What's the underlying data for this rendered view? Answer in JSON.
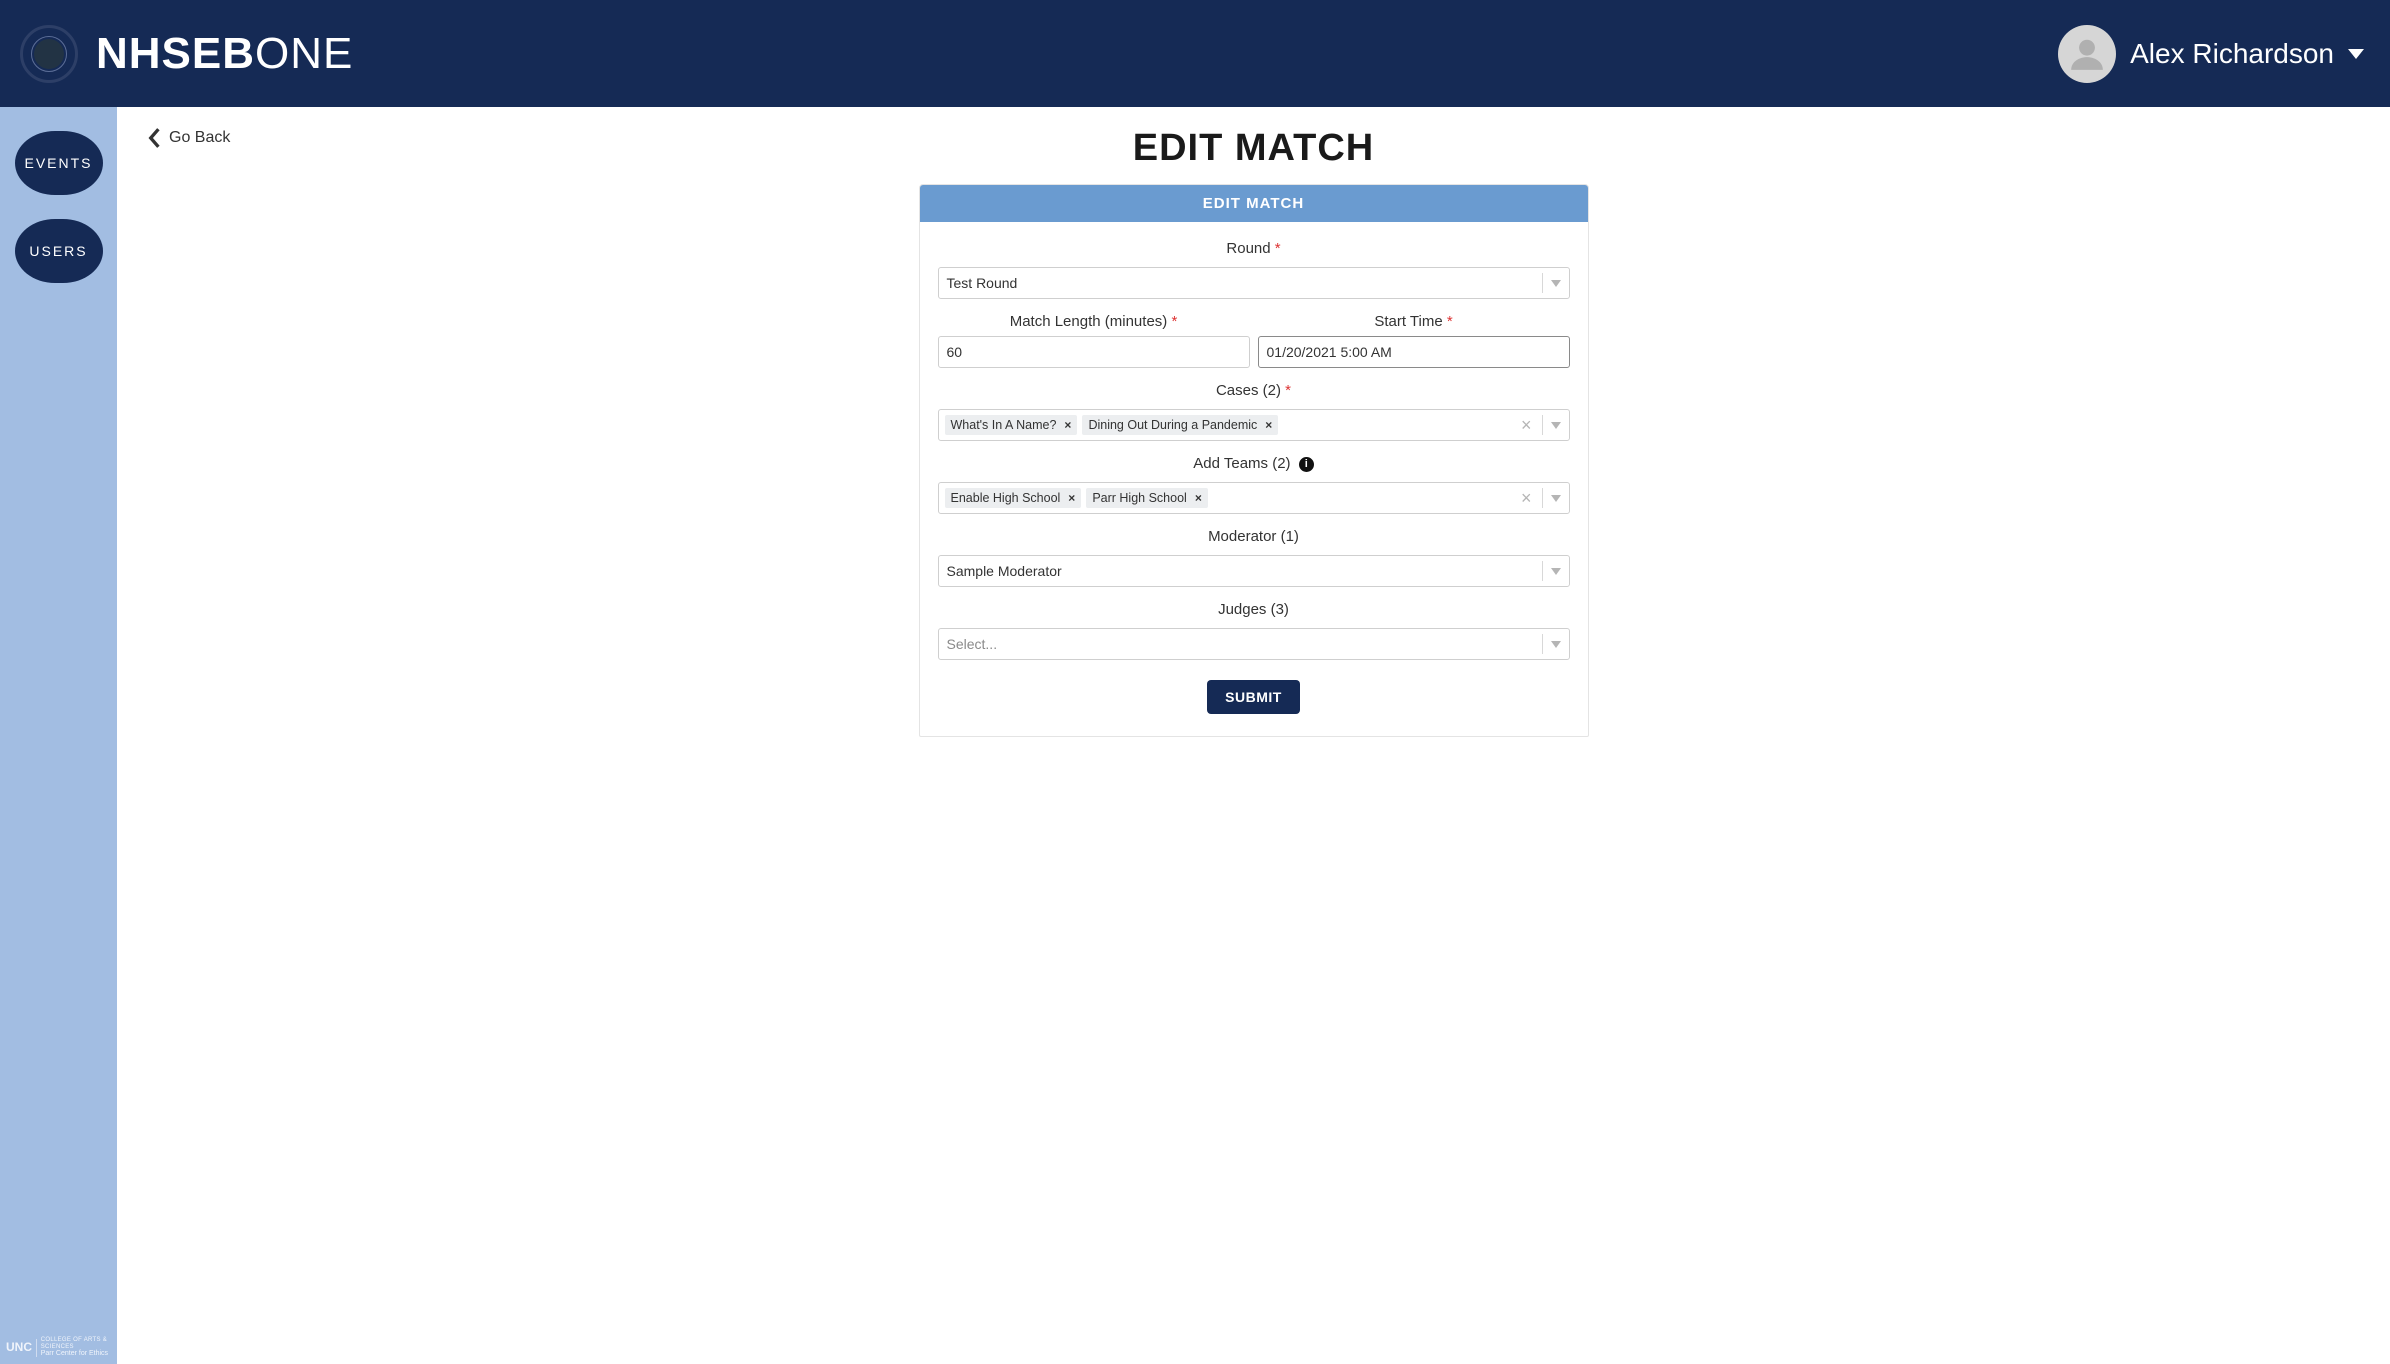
{
  "header": {
    "brand_bold": "NHSEB",
    "brand_light": "ONE",
    "user_name": "Alex Richardson"
  },
  "sidebar": {
    "items": [
      {
        "label": "EVENTS"
      },
      {
        "label": "USERS"
      }
    ],
    "footer_org": "UNC",
    "footer_line1": "COLLEGE OF ARTS & SCIENCES",
    "footer_line2": "Parr Center for Ethics"
  },
  "main": {
    "go_back": "Go Back",
    "page_title": "EDIT MATCH",
    "card_header": "EDIT MATCH",
    "labels": {
      "round": "Round",
      "match_length": "Match Length (minutes)",
      "start_time": "Start Time",
      "cases": "Cases (2)",
      "add_teams": "Add Teams (2)",
      "moderator": "Moderator (1)",
      "judges": "Judges (3)"
    },
    "required_marker": "*",
    "info_char": "i",
    "values": {
      "round": "Test Round",
      "match_length": "60",
      "start_time": "01/20/2021 5:00 AM",
      "cases": [
        "What's In A Name?",
        "Dining Out During a Pandemic"
      ],
      "teams": [
        "Enable High School",
        "Parr High School"
      ],
      "moderator": "Sample Moderator",
      "judges_placeholder": "Select..."
    },
    "tag_close": "×",
    "clear_char": "×",
    "submit": "SUBMIT"
  }
}
